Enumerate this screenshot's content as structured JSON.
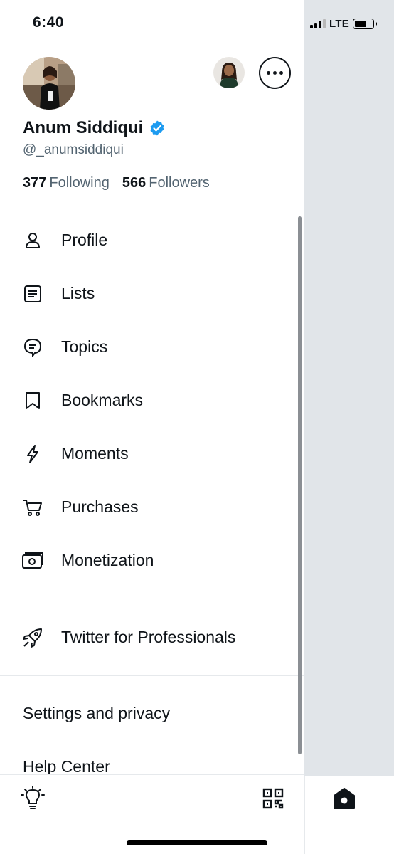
{
  "status_bar": {
    "time": "6:40",
    "network": "LTE"
  },
  "profile": {
    "name": "Anum Siddiqui",
    "handle": "@_anumsiddiqui",
    "following_count": "377",
    "following_label": "Following",
    "followers_count": "566",
    "followers_label": "Followers"
  },
  "menu": {
    "items": [
      {
        "label": "Profile",
        "icon": "person-icon"
      },
      {
        "label": "Lists",
        "icon": "list-icon"
      },
      {
        "label": "Topics",
        "icon": "topics-icon"
      },
      {
        "label": "Bookmarks",
        "icon": "bookmark-icon"
      },
      {
        "label": "Moments",
        "icon": "lightning-icon"
      },
      {
        "label": "Purchases",
        "icon": "cart-icon"
      },
      {
        "label": "Monetization",
        "icon": "money-icon"
      }
    ],
    "professional": {
      "label": "Twitter for Professionals",
      "icon": "rocket-icon"
    },
    "settings_label": "Settings and privacy",
    "help_label": "Help Center"
  },
  "colors": {
    "verified": "#1d9bf0",
    "text": "#0f1419",
    "secondary": "#536471",
    "underlay": "#e1e5e9"
  }
}
